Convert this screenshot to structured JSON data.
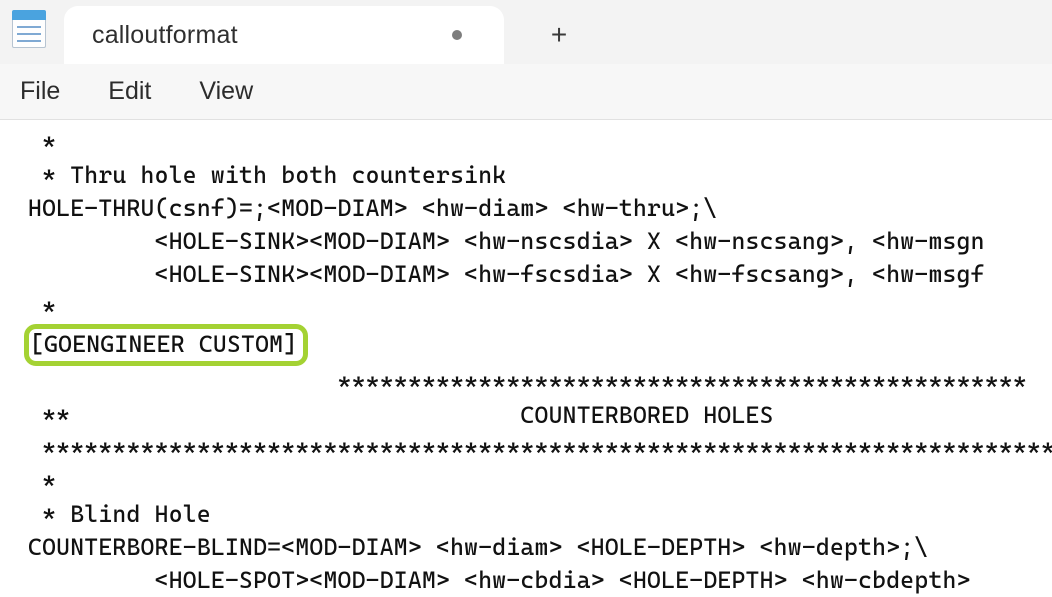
{
  "app": {
    "tab_title": "calloutformat",
    "modified": true
  },
  "menu": {
    "file": "File",
    "edit": "Edit",
    "view": "View"
  },
  "text": {
    "l1": " *",
    "l2": " * Thru hole with both countersink",
    "l3": "HOLE-THRU(csnf)=;<MOD-DIAM> <hw-diam> <hw-thru>;\\",
    "l4": "         <HOLE-SINK><MOD-DIAM> <hw-nscsdia> X <hw-nscsang>, <hw-msgn",
    "l5": "         <HOLE-SINK><MOD-DIAM> <hw-fscsdia> X <hw-fscsang>, <hw-msgf",
    "l6": " *",
    "highlight": "[GOENGINEER CUSTOM]",
    "l8": "                      *************************************************",
    "l9": " **                                COUNTERBORED HOLES",
    "l10": " ************************************************************************",
    "l11": " *",
    "l12": " * Blind Hole",
    "l13": "COUNTERBORE-BLIND=<MOD-DIAM> <hw-diam> <HOLE-DEPTH> <hw-depth>;\\",
    "l14": "         <HOLE-SPOT><MOD-DIAM> <hw-cbdia> <HOLE-DEPTH> <hw-cbdepth>"
  }
}
